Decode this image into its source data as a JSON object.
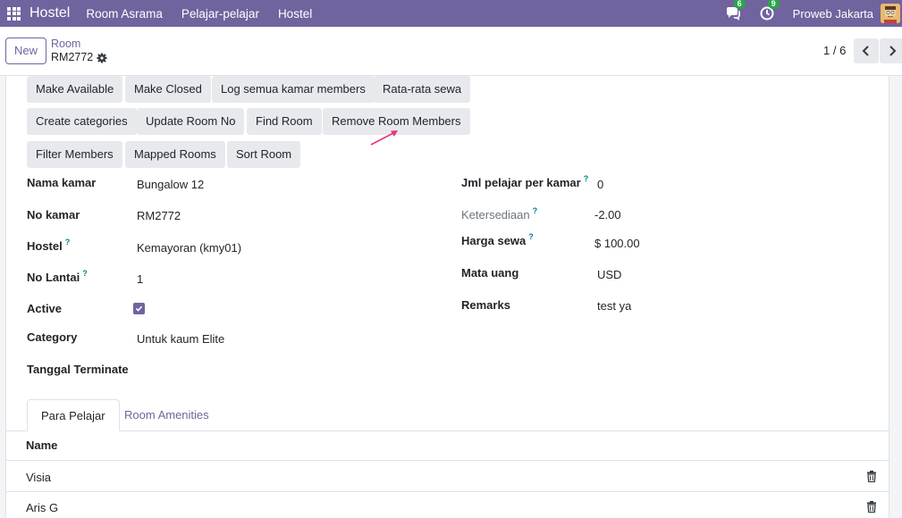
{
  "navbar": {
    "brand": "Hostel",
    "menus": [
      "Room Asrama",
      "Pelajar-pelajar",
      "Hostel"
    ],
    "messages_count": "6",
    "activities_count": "9",
    "company": "Proweb Jakarta",
    "color": "#71639e"
  },
  "control": {
    "new_label": "New",
    "breadcrumb_parent": "Room",
    "breadcrumb_current": "RM2772",
    "pager": "1 / 6"
  },
  "actions": {
    "row1": [
      "Make Available",
      "Make Closed",
      "Log semua kamar members",
      "Rata-rata sewa"
    ],
    "row2": [
      "Create categories",
      "Update Room No",
      "Find Room",
      "Remove Room Members"
    ],
    "row3": [
      "Filter Members",
      "Mapped Rooms",
      "Sort Room"
    ]
  },
  "form": {
    "left": [
      {
        "label": "Nama kamar",
        "value": "Bungalow 12"
      },
      {
        "label": "No kamar",
        "value": "RM2772"
      },
      {
        "label": "Hostel",
        "value": "Kemayoran (kmy01)",
        "help": "?"
      },
      {
        "label": "No Lantai",
        "value": "1",
        "help": "?"
      },
      {
        "label": "Active",
        "value": true
      },
      {
        "label": "Category",
        "value": "Untuk kaum Elite"
      },
      {
        "label": "Tanggal Terminate",
        "value": ""
      }
    ],
    "right": [
      {
        "label": "Jml pelajar per kamar",
        "value": "0",
        "help": "?"
      },
      {
        "label": "Ketersediaan",
        "value": "-2.00",
        "help": "?"
      },
      {
        "label": "Harga sewa",
        "value": "$ 100.00",
        "help": "?"
      },
      {
        "label": "Mata uang",
        "value": "USD"
      },
      {
        "label": "Remarks",
        "value": "test ya"
      }
    ]
  },
  "tabs": [
    "Para Pelajar",
    "Room Amenities"
  ],
  "list": {
    "header": "Name",
    "rows": [
      "Visia",
      "Aris G"
    ]
  }
}
